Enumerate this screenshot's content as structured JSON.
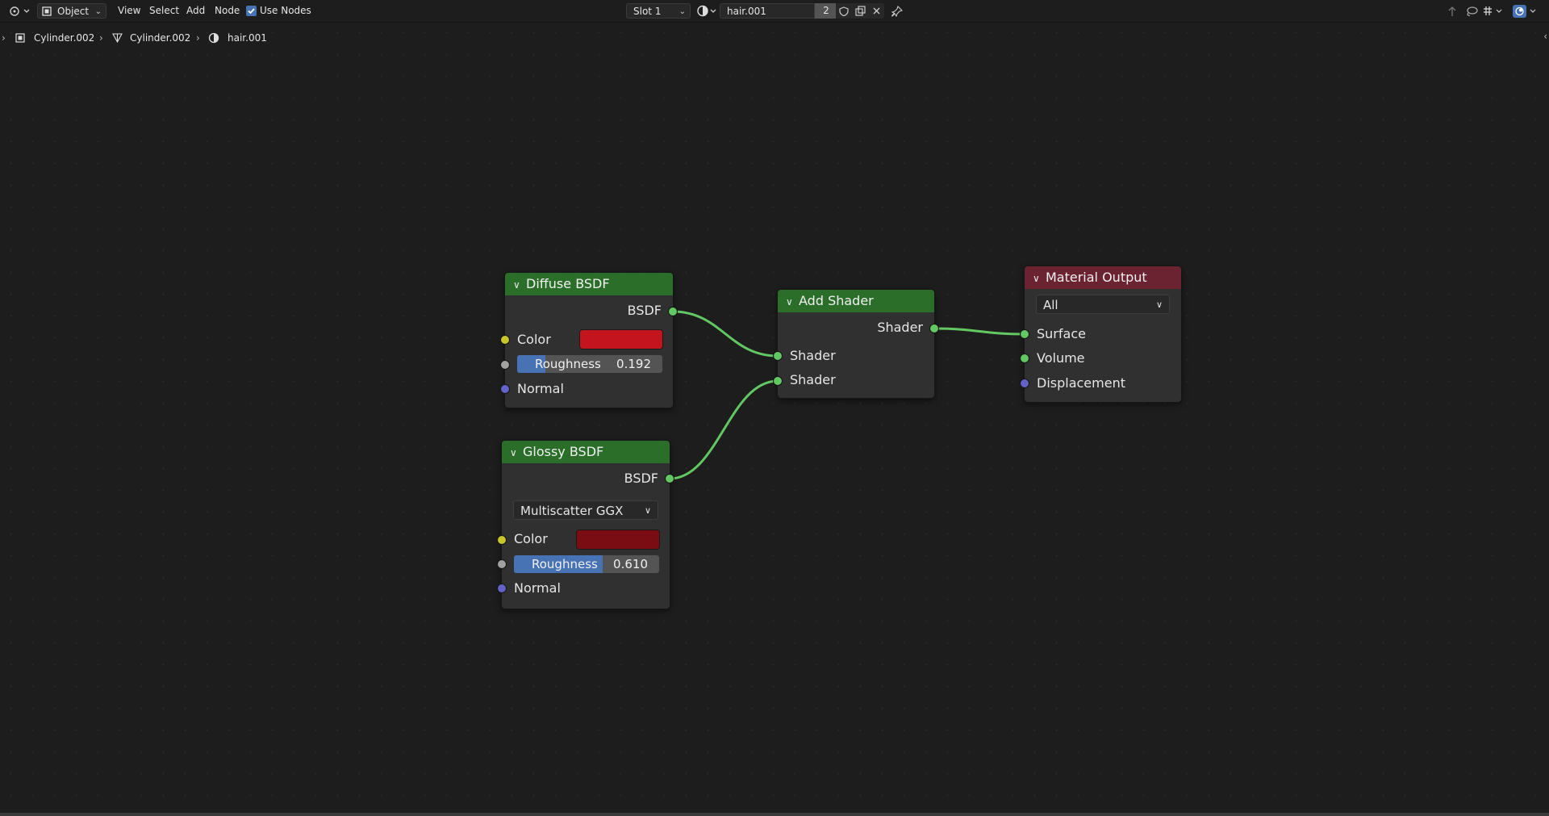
{
  "header": {
    "mode": "Object",
    "menus": [
      "View",
      "Select",
      "Add",
      "Node"
    ],
    "use_nodes_label": "Use Nodes",
    "use_nodes_checked": true,
    "slot": "Slot 1",
    "material_name": "hair.001",
    "users_count": "2"
  },
  "breadcrumb": {
    "object": "Cylinder.002",
    "mesh": "Cylinder.002",
    "material": "hair.001"
  },
  "socket_colors": {
    "shader": "#63c763",
    "color": "#c7c729",
    "float": "#a1a1a1",
    "vector": "#6363c7"
  },
  "nodes": {
    "diffuse": {
      "title": "Diffuse BSDF",
      "header_color": "#2a6e2a",
      "output": "BSDF",
      "color_label": "Color",
      "color_value": "#c4141d",
      "roughness_label": "Roughness",
      "roughness_value": "0.192",
      "roughness_fraction": 0.192,
      "normal_label": "Normal"
    },
    "glossy": {
      "title": "Glossy BSDF",
      "header_color": "#2a6e2a",
      "output": "BSDF",
      "distribution": "Multiscatter GGX",
      "color_label": "Color",
      "color_value": "#7a0c14",
      "roughness_label": "Roughness",
      "roughness_value": "0.610",
      "roughness_fraction": 0.61,
      "normal_label": "Normal"
    },
    "add_shader": {
      "title": "Add Shader",
      "header_color": "#2a6e2a",
      "output": "Shader",
      "input1": "Shader",
      "input2": "Shader"
    },
    "material_output": {
      "title": "Material Output",
      "header_color": "#6b2231",
      "target": "All",
      "inputs": [
        "Surface",
        "Volume",
        "Displacement"
      ]
    }
  }
}
